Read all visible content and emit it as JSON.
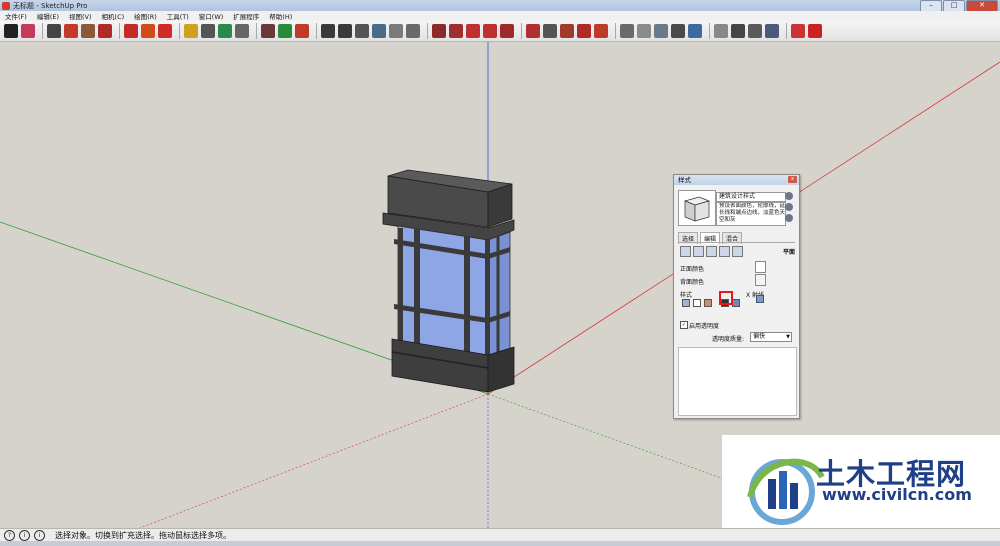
{
  "window": {
    "title": "无标题 - SketchUp Pro",
    "controls": {
      "minimize": "–",
      "maximize": "□",
      "close": "✕"
    }
  },
  "menu": {
    "items": [
      {
        "label": "文件(F)"
      },
      {
        "label": "编辑(E)"
      },
      {
        "label": "视图(V)"
      },
      {
        "label": "相机(C)"
      },
      {
        "label": "绘图(R)"
      },
      {
        "label": "工具(T)"
      },
      {
        "label": "窗口(W)"
      },
      {
        "label": "扩展程序"
      },
      {
        "label": "帮助(H)"
      }
    ]
  },
  "toolbar": {
    "tool_colors": [
      "#222222",
      "#c33a5a",
      "#444444",
      "#c43a2a",
      "#8a5a3a",
      "#b02a2a",
      "#c32a2a",
      "#d04a1a",
      "#d02a2a",
      "#d0a020",
      "#555555",
      "#2a8a4a",
      "#666666",
      "#6a3a3a",
      "#2a8a3a",
      "#c03a2a",
      "#3a3a3a",
      "#3a3a3a",
      "#555555",
      "#4a6a8a",
      "#7a7a7a",
      "#6a6a6a",
      "#8a2a2a",
      "#a03030",
      "#c03030",
      "#c03030",
      "#a02a2a",
      "#b03030",
      "#555555",
      "#a03a2a",
      "#b02a2a",
      "#c03a2a",
      "#6a6a6a",
      "#8a8a8a",
      "#6a7a8a",
      "#4a4a4a",
      "#3a6aa0",
      "#888888",
      "#444444",
      "#5a5a5a",
      "#4a5a7a",
      "#cc3333",
      "#cc2222"
    ]
  },
  "status": {
    "text": "选择对象。切换到扩充选择。拖动鼠标选择多项。",
    "icons": [
      "?",
      "i",
      "i"
    ]
  },
  "styles_panel": {
    "title": "样式",
    "close": "x",
    "style_name": "建筑设计样式",
    "style_description": "预设表面颜色，轮廓线，延长线和端点边线，淡蓝色天空和灰",
    "tabs": [
      {
        "label": "选择"
      },
      {
        "label": "编辑"
      },
      {
        "label": "混合"
      }
    ],
    "flat_label": "平面",
    "front_color_label": "正面颜色",
    "back_color_label": "背面颜色",
    "style_label": "样式",
    "xray_label": "X 射线",
    "enable_transparency_label": "启用透明度",
    "transparency_quality_label": "透明度质量:",
    "transparency_quality_value": "偏快",
    "checkbox_mark": "✓"
  },
  "watermark": {
    "name": "土木工程网",
    "url": "www.civilcn.com"
  },
  "colors": {
    "axis_red": "#d33a3a",
    "axis_green": "#2ca02c",
    "axis_blue": "#3b52c8",
    "frame": "#3a3a3a",
    "glass": "#8ea6e6",
    "highlight": "#e8181e",
    "brand": "#1f3f88"
  }
}
